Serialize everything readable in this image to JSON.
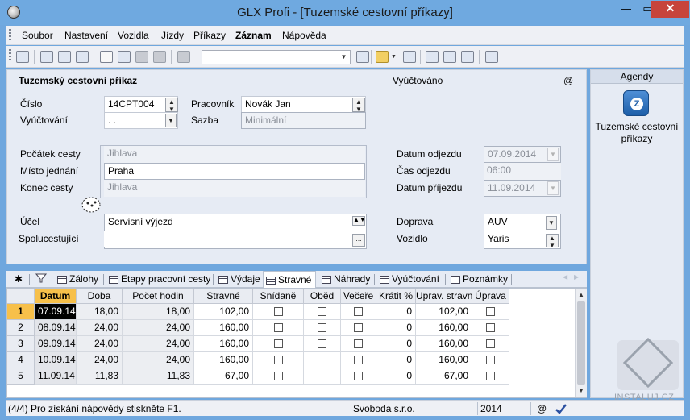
{
  "window": {
    "title": "GLX Profi - [Tuzemské cestovní příkazy]",
    "close_glyph": "✕",
    "minimize_glyph": "—",
    "maximize_glyph": "▭"
  },
  "menubar": {
    "items": [
      "Soubor",
      "Nastavení",
      "Vozidla",
      "Jízdy",
      "Příkazy",
      "Záznam",
      "Nápověda"
    ]
  },
  "toolbar": {
    "search_value": ""
  },
  "form": {
    "header": "Tuzemský cestovní příkaz",
    "vyuctovano_label": "Vyúčtováno",
    "at_symbol": "@",
    "cislo_label": "Číslo",
    "cislo_value": "14CPT004",
    "vyuctovani_label": "Vyúčtování",
    "vyuctovani_value": ". .",
    "pracovnik_label": "Pracovník",
    "pracovnik_value": "Novák Jan",
    "sazba_label": "Sazba",
    "sazba_value": "Minimální",
    "pocatek_label": "Počátek cesty",
    "pocatek_value": "Jihlava",
    "misto_label": "Místo jednání",
    "misto_value": "Praha",
    "konec_label": "Konec cesty",
    "konec_value": "Jihlava",
    "datum_odjezdu_label": "Datum odjezdu",
    "datum_odjezdu_value": "07.09.2014",
    "cas_odjezdu_label": "Čas odjezdu",
    "cas_odjezdu_value": "06:00",
    "datum_prijezdu_label": "Datum příjezdu",
    "datum_prijezdu_value": "11.09.2014",
    "ucel_label": "Účel",
    "ucel_value": "Servisní výjezd",
    "spolucestujici_label": "Spolucestující",
    "spolucestujici_value": "",
    "doprava_label": "Doprava",
    "doprava_value": "AUV",
    "vozidlo_label": "Vozidlo",
    "vozidlo_value": "Yaris"
  },
  "agendy": {
    "header": "Agendy",
    "item_label": "Tuzemské cestovní příkazy"
  },
  "tabs": {
    "star": "✱",
    "items": [
      "Zálohy",
      "Etapy pracovní cesty",
      "Výdaje",
      "Stravné",
      "Náhrady",
      "Vyúčtování",
      "Poznámky"
    ],
    "active": "Stravné"
  },
  "grid": {
    "columns": [
      "Datum",
      "Doba",
      "Počet hodin",
      "Stravné",
      "Snídaně",
      "Oběd",
      "Večeře",
      "Krátit %",
      "Uprav. stravn",
      "Úprava"
    ],
    "rows": [
      {
        "n": "1",
        "datum": "07.09.14",
        "doba": "18,00",
        "hodin": "18,00",
        "stravne": "102,00",
        "kratit": "0",
        "uprav": "102,00"
      },
      {
        "n": "2",
        "datum": "08.09.14",
        "doba": "24,00",
        "hodin": "24,00",
        "stravne": "160,00",
        "kratit": "0",
        "uprav": "160,00"
      },
      {
        "n": "3",
        "datum": "09.09.14",
        "doba": "24,00",
        "hodin": "24,00",
        "stravne": "160,00",
        "kratit": "0",
        "uprav": "160,00"
      },
      {
        "n": "4",
        "datum": "10.09.14",
        "doba": "24,00",
        "hodin": "24,00",
        "stravne": "160,00",
        "kratit": "0",
        "uprav": "160,00"
      },
      {
        "n": "5",
        "datum": "11.09.14",
        "doba": "11,83",
        "hodin": "11,83",
        "stravne": "67,00",
        "kratit": "0",
        "uprav": "67,00"
      }
    ]
  },
  "status": {
    "help": "(4/4) Pro získání nápovědy stiskněte F1.",
    "company": "Svoboda s.r.o.",
    "year": "2014",
    "at_symbol": "@"
  },
  "watermark": {
    "text": "INSTALUJ.CZ"
  }
}
